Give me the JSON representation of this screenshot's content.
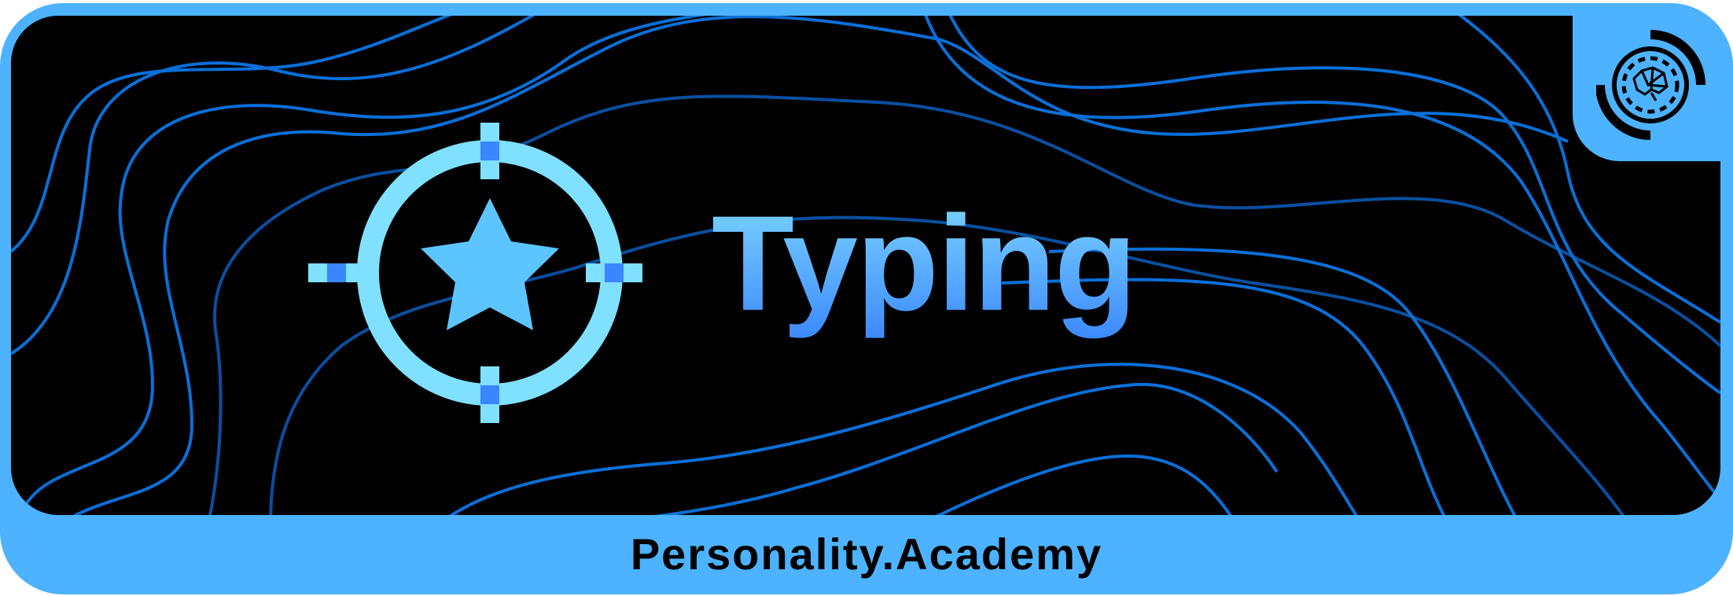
{
  "banner": {
    "title": "Typing",
    "brand": "Personality.Academy",
    "icons": [
      "target-star-icon",
      "brain-logo-icon"
    ],
    "colors": {
      "frame": "#4db2ff",
      "background": "#000000",
      "contour": "#0a6fd8",
      "title_top": "#82dcff",
      "title_bottom": "#3a86ff"
    }
  }
}
